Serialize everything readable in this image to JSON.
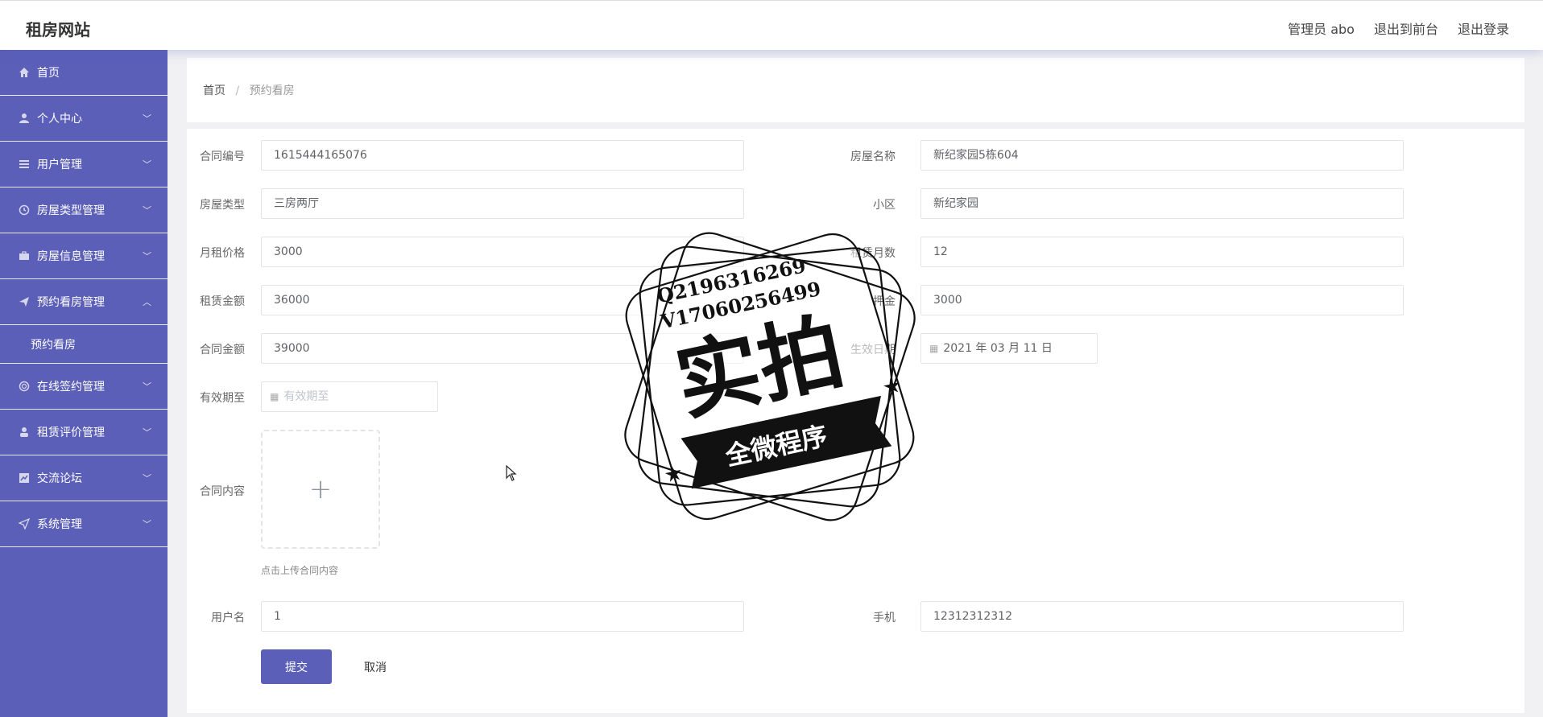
{
  "header": {
    "brand": "租房网站",
    "links": [
      "管理员 abo",
      "退出到前台",
      "退出登录"
    ]
  },
  "sidebar": {
    "items": [
      {
        "label": "首页",
        "icon": "home-icon"
      },
      {
        "label": "个人中心",
        "icon": "user-icon"
      },
      {
        "label": "用户管理",
        "icon": "list-icon"
      },
      {
        "label": "房屋类型管理",
        "icon": "clock-icon"
      },
      {
        "label": "房屋信息管理",
        "icon": "briefcase-icon"
      },
      {
        "label": "预约看房管理",
        "icon": "send-icon",
        "expanded": true,
        "children": [
          "预约看房"
        ]
      },
      {
        "label": "在线签约管理",
        "icon": "circle-icon"
      },
      {
        "label": "租赁评价管理",
        "icon": "person-icon"
      },
      {
        "label": "交流论坛",
        "icon": "chart-icon"
      },
      {
        "label": "系统管理",
        "icon": "navigation-icon"
      }
    ]
  },
  "breadcrumb": {
    "home": "首页",
    "separator": "/",
    "current": "预约看房"
  },
  "form": {
    "contract_no": {
      "label": "合同编号",
      "value": "1615444165076"
    },
    "house_name": {
      "label": "房屋名称",
      "value": "新纪家园5栋604"
    },
    "house_type": {
      "label": "房屋类型",
      "value": "三房两厅"
    },
    "community": {
      "label": "小区",
      "value": "新纪家园"
    },
    "monthly_rent": {
      "label": "月租价格",
      "value": "3000"
    },
    "lease_months": {
      "label": "租赁月数",
      "value": "12"
    },
    "lease_amount": {
      "label": "租赁金额",
      "value": "36000"
    },
    "deposit": {
      "label": "押金",
      "value": "3000"
    },
    "contract_amount": {
      "label": "合同金额",
      "value": "39000"
    },
    "effective_date": {
      "label": "生效日期",
      "value": "2021 年 03 月 11 日"
    },
    "valid_until": {
      "label": "有效期至",
      "placeholder": "有效期至"
    },
    "contract_content": {
      "label": "合同内容",
      "hint": "点击上传合同内容"
    },
    "username": {
      "label": "用户名",
      "value": "1"
    },
    "phone": {
      "label": "手机",
      "value": "12312312312"
    },
    "submit_label": "提交",
    "cancel_label": "取消"
  },
  "watermark": {
    "lines": [
      "Q2196316269",
      "V17060256499"
    ],
    "main": "实拍",
    "ribbon": "全微程序"
  },
  "colors": {
    "accent": "#5b5fb8"
  }
}
